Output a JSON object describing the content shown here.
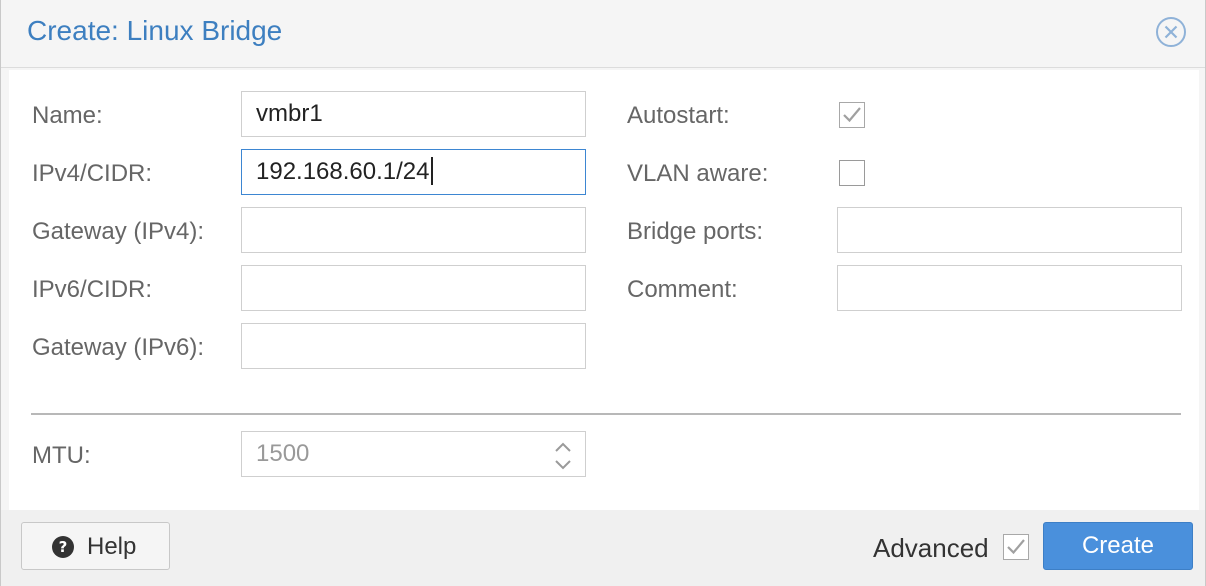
{
  "dialog": {
    "title": "Create: Linux Bridge"
  },
  "form": {
    "name": {
      "label": "Name:",
      "value": "vmbr1"
    },
    "ipv4": {
      "label": "IPv4/CIDR:",
      "value": "192.168.60.1/24"
    },
    "gateway_ipv4": {
      "label": "Gateway (IPv4):",
      "value": ""
    },
    "ipv6": {
      "label": "IPv6/CIDR:",
      "value": ""
    },
    "gateway_ipv6": {
      "label": "Gateway (IPv6):",
      "value": ""
    },
    "autostart": {
      "label": "Autostart:",
      "checked": true
    },
    "vlan_aware": {
      "label": "VLAN aware:",
      "checked": false
    },
    "bridge_ports": {
      "label": "Bridge ports:",
      "value": ""
    },
    "comment": {
      "label": "Comment:",
      "value": ""
    },
    "mtu": {
      "label": "MTU:",
      "placeholder": "1500"
    }
  },
  "footer": {
    "help_label": "Help",
    "advanced_label": "Advanced",
    "advanced_checked": true,
    "create_label": "Create"
  },
  "colors": {
    "accent": "#3d7fc0",
    "primary_button": "#4a90dc",
    "focus_border": "#3d86d2"
  }
}
